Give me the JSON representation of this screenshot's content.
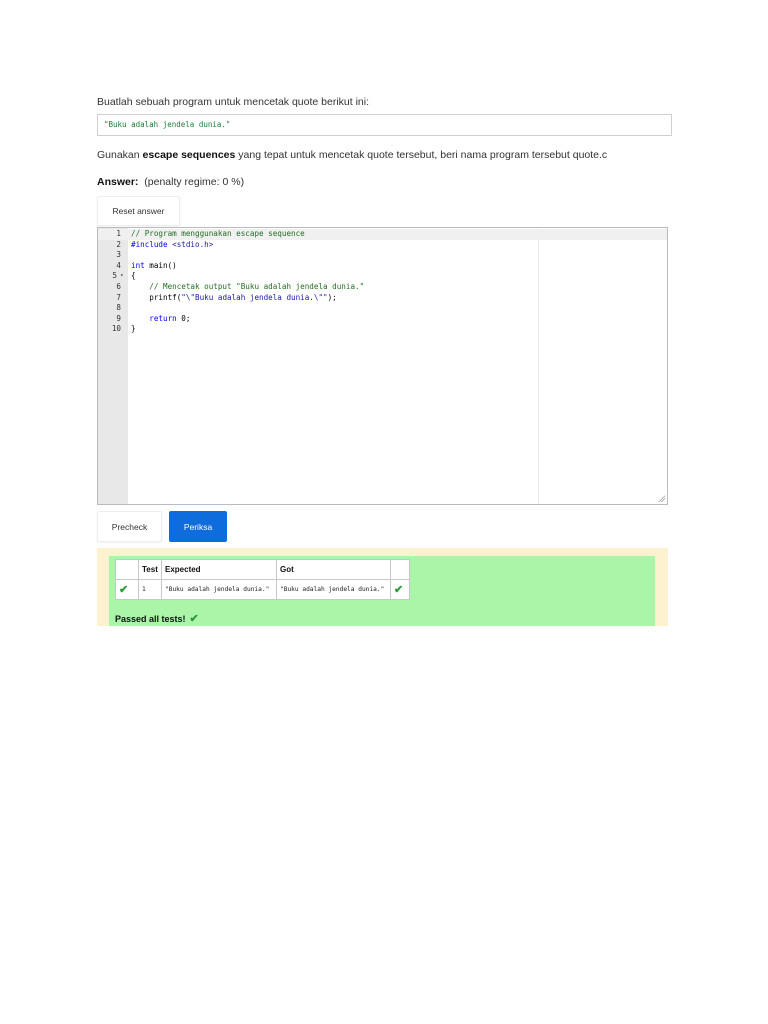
{
  "question": {
    "prompt": "Buatlah sebuah program untuk mencetak quote berikut ini:",
    "quote": "\"Buku adalah jendela dunia.\"",
    "instr_pre": "Gunakan ",
    "instr_bold": "escape sequences",
    "instr_post": " yang tepat untuk mencetak quote tersebut, beri nama program tersebut quote.c"
  },
  "answer": {
    "label": "Answer:",
    "penalty": "(penalty regime: 0 %)",
    "reset_label": "Reset answer"
  },
  "editor": {
    "line_numbers": [
      "1",
      "2",
      "3",
      "4",
      "5",
      "6",
      "7",
      "8",
      "9",
      "10"
    ],
    "fold_marker": "▾",
    "lines": {
      "l1": "// Program menggunakan escape sequence",
      "l2a": "#include",
      "l2b": " <stdio.h>",
      "l4a": "int",
      "l4b": " main()",
      "l5": "{",
      "l6": "    // Mencetak output \"Buku adalah jendela dunia.\"",
      "l7a": "    printf(",
      "l7b": "\"\\\"Buku adalah jendela dunia.\\\"\"",
      "l7c": ");",
      "l9a": "    return",
      "l9b": " 0;",
      "l10": "}"
    }
  },
  "buttons": {
    "precheck": "Precheck",
    "periksa": "Periksa"
  },
  "results": {
    "headers": [
      "",
      "Test",
      "Expected",
      "Got",
      ""
    ],
    "rows": [
      {
        "test": "1",
        "expected": "\"Buku adalah jendela dunia.\"",
        "got": "\"Buku adalah jendela dunia.\""
      }
    ],
    "passed_label": "Passed all tests!",
    "check_glyph": "✔"
  },
  "colors": {
    "accent": "#0f6cdc",
    "pass_bg": "#aaf5a8",
    "outer_bg": "#fdf2cf"
  }
}
